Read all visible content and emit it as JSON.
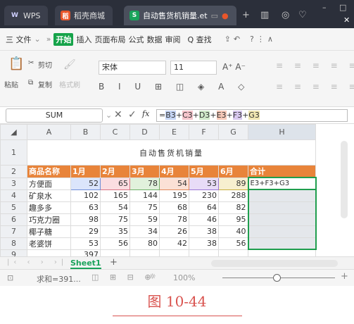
{
  "tabs": {
    "wps": "WPS",
    "store": "稻壳商城",
    "doc": "自动售货机销量.et"
  },
  "menu": {
    "file": "三 文件",
    "more": "»",
    "start": "开始",
    "items": [
      "插入",
      "页面布局",
      "公式",
      "数据",
      "审阅"
    ],
    "search": "Q 查找"
  },
  "ribbon": {
    "paste": "粘贴",
    "cut": "剪切",
    "copy": "复制",
    "format_painter": "格式刷",
    "font_name": "宋体",
    "font_size": "11"
  },
  "formula_bar": {
    "name_box": "SUM",
    "fx": "fx",
    "formula_prefix": "=",
    "refs": [
      "B3",
      "C3",
      "D3",
      "E3",
      "F3",
      "G3"
    ]
  },
  "grid": {
    "columns": [
      "A",
      "B",
      "C",
      "D",
      "E",
      "F",
      "G",
      "H"
    ],
    "title": "自动售货机销量",
    "header": [
      "商品名称",
      "1月",
      "2月",
      "3月",
      "4月",
      "5月",
      "6月",
      "合计"
    ],
    "rows": [
      {
        "name": "方便面",
        "values": [
          "52",
          "65",
          "78",
          "54",
          "53",
          "89"
        ],
        "total": "E3+F3+G3"
      },
      {
        "name": "矿泉水",
        "values": [
          "102",
          "165",
          "144",
          "195",
          "230",
          "288"
        ],
        "total": ""
      },
      {
        "name": "趣多多",
        "values": [
          "63",
          "54",
          "75",
          "68",
          "64",
          "82"
        ],
        "total": ""
      },
      {
        "name": "巧克力圈",
        "values": [
          "98",
          "75",
          "59",
          "78",
          "46",
          "95"
        ],
        "total": ""
      },
      {
        "name": "椰子糖",
        "values": [
          "29",
          "35",
          "34",
          "26",
          "38",
          "40"
        ],
        "total": ""
      },
      {
        "name": "老婆饼",
        "values": [
          "53",
          "56",
          "80",
          "42",
          "38",
          "56"
        ],
        "total": ""
      }
    ],
    "row9_b": "397",
    "row_numbers": [
      "1",
      "2",
      "3",
      "4",
      "5",
      "6",
      "7",
      "8",
      "9"
    ]
  },
  "sheet_tab": "Sheet1",
  "status": {
    "sum": "求和=391...",
    "zoom": "100%"
  },
  "caption": "图 10-44"
}
